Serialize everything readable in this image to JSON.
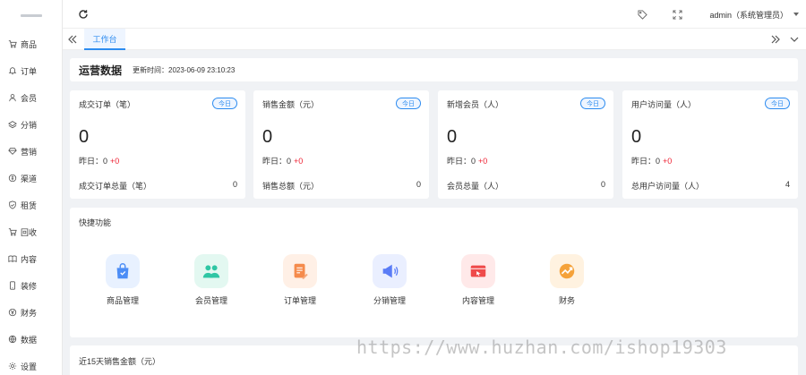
{
  "sidebar": {
    "items": [
      {
        "label": "商品",
        "icon": "cart-icon"
      },
      {
        "label": "订单",
        "icon": "bell-icon"
      },
      {
        "label": "会员",
        "icon": "user-icon"
      },
      {
        "label": "分销",
        "icon": "layers-icon"
      },
      {
        "label": "营销",
        "icon": "diamond-icon"
      },
      {
        "label": "渠道",
        "icon": "coin-icon"
      },
      {
        "label": "租赁",
        "icon": "shield-icon"
      },
      {
        "label": "回收",
        "icon": "cart-icon"
      },
      {
        "label": "内容",
        "icon": "book-icon"
      },
      {
        "label": "装修",
        "icon": "phone-icon"
      },
      {
        "label": "财务",
        "icon": "money-icon"
      },
      {
        "label": "数据",
        "icon": "globe-icon"
      },
      {
        "label": "设置",
        "icon": "gear-icon"
      }
    ]
  },
  "header": {
    "user": "admin（系统管理员）"
  },
  "tabs": {
    "active": "工作台"
  },
  "overview": {
    "title": "运营数据",
    "updated": "更新时间：2023-06-09 23:10:23"
  },
  "stats": [
    {
      "label": "成交订单（笔）",
      "badge": "今日",
      "value": "0",
      "yesterday_label": "昨日：0",
      "yesterday_delta": "+0",
      "total_label": "成交订单总量（笔）",
      "total_value": "0"
    },
    {
      "label": "销售金额（元）",
      "badge": "今日",
      "value": "0",
      "yesterday_label": "昨日：0",
      "yesterday_delta": "+0",
      "total_label": "销售总额（元）",
      "total_value": "0"
    },
    {
      "label": "新增会员（人）",
      "badge": "今日",
      "value": "0",
      "yesterday_label": "昨日：0",
      "yesterday_delta": "+0",
      "total_label": "会员总量（人）",
      "total_value": "0"
    },
    {
      "label": "用户访问量（人）",
      "badge": "今日",
      "value": "0",
      "yesterday_label": "昨日：0",
      "yesterday_delta": "+0",
      "total_label": "总用户访问量（人）",
      "total_value": "4"
    }
  ],
  "quick": {
    "title": "快捷功能",
    "items": [
      {
        "label": "商品管理",
        "icon": "shopping-bag-icon",
        "color": "#4c8df6",
        "bg": "#e8f1ff"
      },
      {
        "label": "会员管理",
        "icon": "members-icon",
        "color": "#2fc6a4",
        "bg": "#e3f8f1"
      },
      {
        "label": "订单管理",
        "icon": "order-icon",
        "color": "#f58b4c",
        "bg": "#fff0e6"
      },
      {
        "label": "分销管理",
        "icon": "megaphone-icon",
        "color": "#5a7cf6",
        "bg": "#eaefff"
      },
      {
        "label": "内容管理",
        "icon": "content-icon",
        "color": "#ef4a4a",
        "bg": "#ffe9e9"
      },
      {
        "label": "财务",
        "icon": "finance-icon",
        "color": "#f5a23a",
        "bg": "#fff2e0"
      }
    ]
  },
  "bottom": {
    "title": "近15天销售金额（元）"
  },
  "watermark": "https://www.huzhan.com/ishop19303"
}
